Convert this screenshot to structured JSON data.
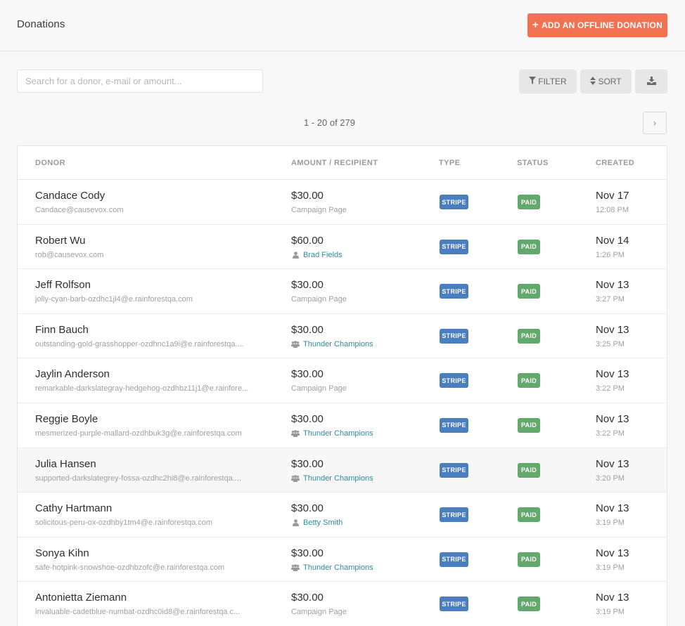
{
  "header": {
    "title": "Donations",
    "add_button_label": "ADD AN OFFLINE DONATION",
    "add_button_icon": "plus-icon",
    "accent_color": "#f17152"
  },
  "toolbar": {
    "search_placeholder": "Search for a donor, e-mail or amount...",
    "search_value": "",
    "filter_label": "FILTER",
    "filter_icon": "filter-icon",
    "sort_label": "SORT",
    "sort_icon": "sort-icon",
    "download_icon": "download-icon"
  },
  "pagination": {
    "summary": "1 - 20 of 279",
    "next_icon": "chevron-right-icon",
    "next_label": "›"
  },
  "table": {
    "columns": [
      "DONOR",
      "AMOUNT / RECIPIENT",
      "TYPE",
      "STATUS",
      "CREATED"
    ],
    "type_color": "#4a7ebf",
    "status_color": "#63a86c",
    "link_color": "#2f8b9e",
    "rows": [
      {
        "name": "Candace Cody",
        "email": "Candace@causevox.com",
        "amount": "$30.00",
        "recipient": "Campaign Page",
        "recipient_type": "campaign",
        "type": "STRIPE",
        "status": "PAID",
        "date": "Nov 17",
        "time": "12:08 PM"
      },
      {
        "name": "Robert Wu",
        "email": "rob@causevox.com",
        "amount": "$60.00",
        "recipient": "Brad Fields",
        "recipient_type": "individual",
        "type": "STRIPE",
        "status": "PAID",
        "date": "Nov 14",
        "time": "1:26 PM"
      },
      {
        "name": "Jeff Rolfson",
        "email": "jolly-cyan-barb-ozdhc1jl4@e.rainforestqa.com",
        "amount": "$30.00",
        "recipient": "Campaign Page",
        "recipient_type": "campaign",
        "type": "STRIPE",
        "status": "PAID",
        "date": "Nov 13",
        "time": "3:27 PM"
      },
      {
        "name": "Finn Bauch",
        "email": "outstanding-gold-grasshopper-ozdhnc1a9i@e.rainforestqa....",
        "amount": "$30.00",
        "recipient": "Thunder Champions",
        "recipient_type": "team",
        "type": "STRIPE",
        "status": "PAID",
        "date": "Nov 13",
        "time": "3:25 PM"
      },
      {
        "name": "Jaylin Anderson",
        "email": "remarkable-darkslategray-hedgehog-ozdhbz11j1@e.rainfore...",
        "amount": "$30.00",
        "recipient": "Campaign Page",
        "recipient_type": "campaign",
        "type": "STRIPE",
        "status": "PAID",
        "date": "Nov 13",
        "time": "3:22 PM"
      },
      {
        "name": "Reggie Boyle",
        "email": "mesmerized-purple-mallard-ozdhbuk3g@e.rainforestqa.com",
        "amount": "$30.00",
        "recipient": "Thunder Champions",
        "recipient_type": "team",
        "type": "STRIPE",
        "status": "PAID",
        "date": "Nov 13",
        "time": "3:22 PM"
      },
      {
        "name": "Julia Hansen",
        "email": "supported-darkslategrey-fossa-ozdhc2hi8@e.rainforestqa....",
        "amount": "$30.00",
        "recipient": "Thunder Champions",
        "recipient_type": "team",
        "type": "STRIPE",
        "status": "PAID",
        "date": "Nov 13",
        "time": "3:20 PM"
      },
      {
        "name": "Cathy Hartmann",
        "email": "solicitous-peru-ox-ozdhby1tm4@e.rainforestqa.com",
        "amount": "$30.00",
        "recipient": "Betty Smith",
        "recipient_type": "individual",
        "type": "STRIPE",
        "status": "PAID",
        "date": "Nov 13",
        "time": "3:19 PM"
      },
      {
        "name": "Sonya Kihn",
        "email": "safe-hotpink-snowshoe-ozdhbzofc@e.rainforestqa.com",
        "amount": "$30.00",
        "recipient": "Thunder Champions",
        "recipient_type": "team",
        "type": "STRIPE",
        "status": "PAID",
        "date": "Nov 13",
        "time": "3:19 PM"
      },
      {
        "name": "Antonietta Ziemann",
        "email": "invaluable-cadetblue-numbat-ozdhc0id8@e.rainforestqa.c...",
        "amount": "$30.00",
        "recipient": "Campaign Page",
        "recipient_type": "campaign",
        "type": "STRIPE",
        "status": "PAID",
        "date": "Nov 13",
        "time": "3:19 PM"
      }
    ]
  }
}
